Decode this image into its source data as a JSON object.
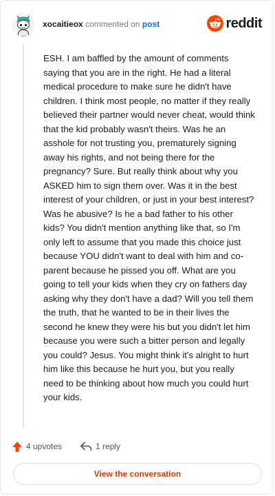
{
  "comment": {
    "username": "xocaitieox",
    "verb": "commented on",
    "post_link": "post",
    "body": "ESH. I am baffled by the amount of comments saying that you are in the right. He had a literal medical procedure to make sure he didn't have children. I think most people, no matter if they really believed their partner would never cheat, would think that the kid probably wasn't theirs. Was he an asshole for not trusting you, prematurely signing away his rights, and not being there for the pregnancy? Sure. But really think about why you ASKED him to sign them over. Was it in the best interest of your children, or just in your best interest? Was he abusive? Is he a bad father to his other kids? You didn't mention anything like that, so I'm only left to assume that you made this choice just because YOU didn't want to deal with him and co-parent because he pissed you off. What are you going to tell your kids when they cry on fathers day asking why they don't have a dad? Will you tell them the truth, that he wanted to be in their lives the second he knew they were his but you didn't let him because you were such a bitter person and legally you could? Jesus. You might think it's alright to hurt him like this because he hurt you, but you really need to be thinking about how much you could hurt your kids."
  },
  "brand": {
    "name": "reddit",
    "icon": "reddit-snoo-icon",
    "color": "#ff4500"
  },
  "actions": {
    "upvotes_label": "4 upvotes",
    "upvote_icon": "upvote-arrow-icon",
    "upvote_color": "#ff4500",
    "replies_label": "1 reply",
    "reply_icon": "reply-arrow-icon"
  },
  "cta": {
    "label": "View the conversation",
    "color": "#d93a00"
  }
}
